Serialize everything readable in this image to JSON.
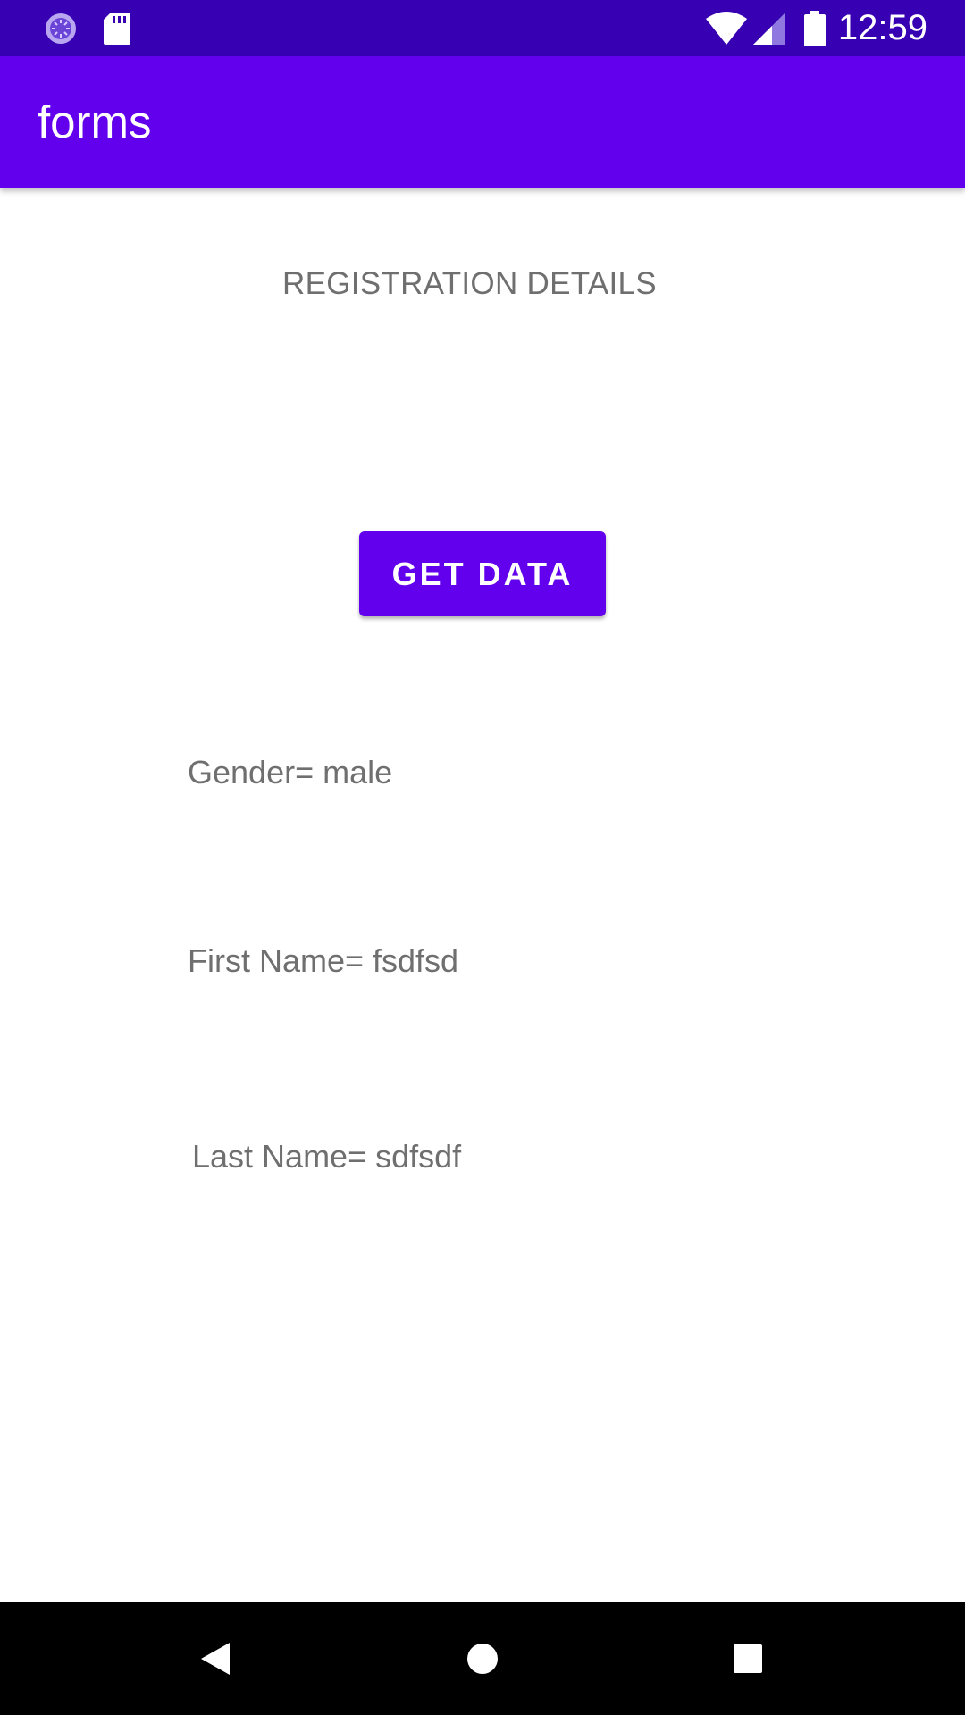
{
  "status_bar": {
    "time": "12:59",
    "icons": [
      "sync-icon",
      "sd-card-icon",
      "wifi-icon",
      "cell-signal-icon",
      "battery-icon"
    ]
  },
  "app_bar": {
    "title": "forms"
  },
  "main": {
    "heading": "REGISTRATION DETAILS",
    "get_data_label": "GET DATA",
    "gender_text": "Gender= male",
    "first_name_text": "First Name= fsdfsd",
    "last_name_text": "Last Name= sdfsdf"
  },
  "nav_bar": {
    "buttons": [
      "back-icon",
      "home-icon",
      "recents-icon"
    ]
  },
  "colors": {
    "status_bar": "#3700b3",
    "primary": "#6200ee",
    "text_secondary": "#6f6f6f",
    "nav_bar": "#000000"
  }
}
